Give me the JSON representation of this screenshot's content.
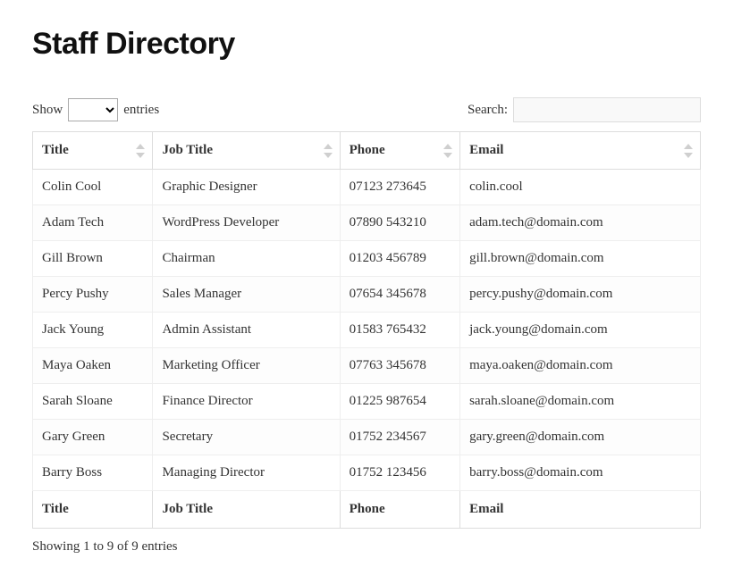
{
  "page_title": "Staff Directory",
  "controls": {
    "show_label": "Show",
    "entries_label": "entries",
    "search_label": "Search:",
    "search_value": ""
  },
  "columns": {
    "title": "Title",
    "job_title": "Job Title",
    "phone": "Phone",
    "email": "Email"
  },
  "rows": [
    {
      "title": "Colin Cool",
      "job": "Graphic Designer",
      "phone": "07123 273645",
      "email": "colin.cool"
    },
    {
      "title": "Adam Tech",
      "job": "WordPress Developer",
      "phone": "07890 543210",
      "email": "adam.tech@domain.com"
    },
    {
      "title": "Gill Brown",
      "job": "Chairman",
      "phone": "01203 456789",
      "email": "gill.brown@domain.com"
    },
    {
      "title": "Percy Pushy",
      "job": "Sales Manager",
      "phone": "07654 345678",
      "email": "percy.pushy@domain.com"
    },
    {
      "title": "Jack Young",
      "job": "Admin Assistant",
      "phone": "01583 765432",
      "email": "jack.young@domain.com"
    },
    {
      "title": "Maya Oaken",
      "job": "Marketing Officer",
      "phone": "07763 345678",
      "email": "maya.oaken@domain.com"
    },
    {
      "title": "Sarah Sloane",
      "job": "Finance Director",
      "phone": "01225 987654",
      "email": "sarah.sloane@domain.com"
    },
    {
      "title": "Gary Green",
      "job": "Secretary",
      "phone": "01752 234567",
      "email": "gary.green@domain.com"
    },
    {
      "title": "Barry Boss",
      "job": "Managing Director",
      "phone": "01752 123456",
      "email": "barry.boss@domain.com"
    }
  ],
  "info_text": "Showing 1 to 9 of 9 entries"
}
